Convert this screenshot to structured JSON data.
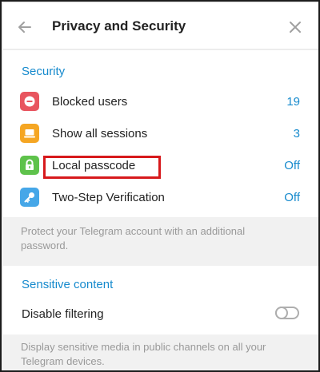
{
  "header": {
    "title": "Privacy and Security",
    "back_icon": "arrow-left-icon",
    "close_icon": "close-icon"
  },
  "security": {
    "section_title": "Security",
    "items": [
      {
        "label": "Blocked users",
        "value": "19",
        "icon": "minus-circle-icon",
        "icon_color": "#e8555f"
      },
      {
        "label": "Show all sessions",
        "value": "3",
        "icon": "laptop-icon",
        "icon_color": "#f5a623"
      },
      {
        "label": "Local passcode",
        "value": "Off",
        "icon": "lock-icon",
        "icon_color": "#5ec24b"
      },
      {
        "label": "Two-Step Verification",
        "value": "Off",
        "icon": "key-icon",
        "icon_color": "#46a7e8"
      }
    ],
    "note": "Protect your Telegram account with an additional password."
  },
  "sensitive": {
    "section_title": "Sensitive content",
    "toggle_label": "Disable filtering",
    "toggle_on": false,
    "note": "Display sensitive media in public channels on all your Telegram devices."
  },
  "colors": {
    "accent": "#168acd",
    "highlight_box": "#d7191c"
  }
}
